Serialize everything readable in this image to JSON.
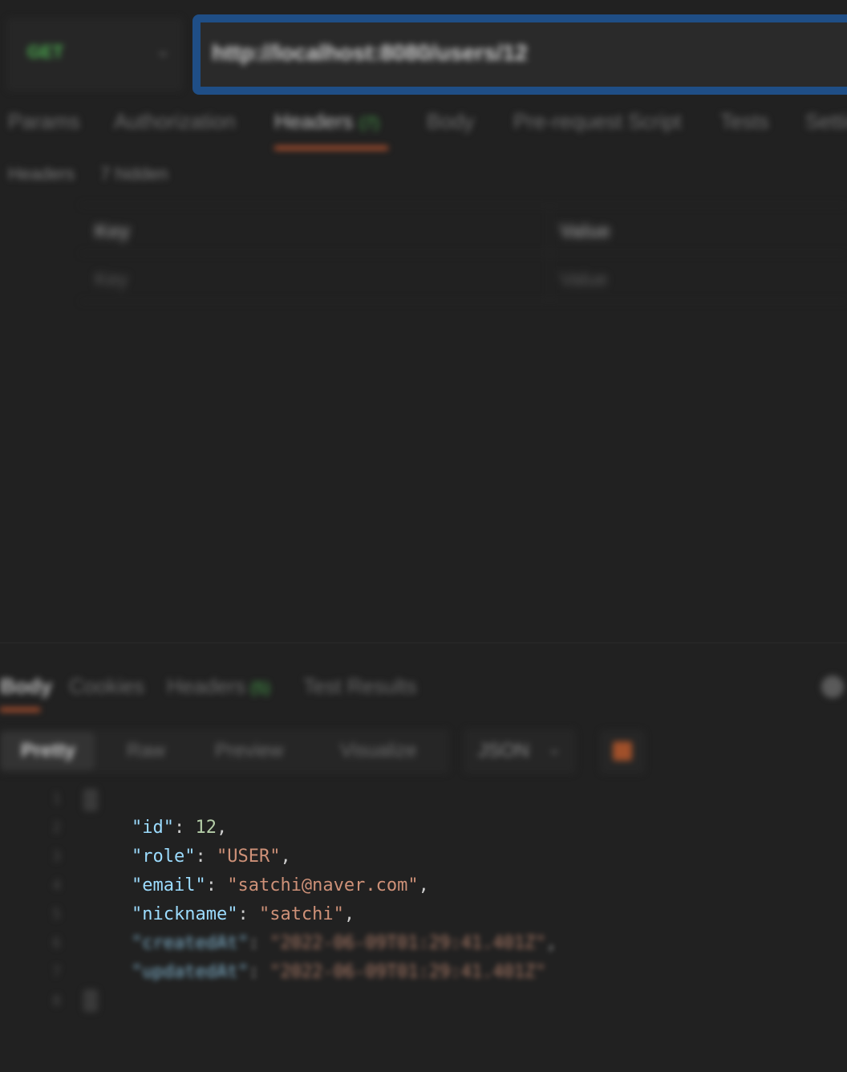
{
  "request": {
    "method": "GET",
    "url": "http://localhost:8080/users/12"
  },
  "request_tabs": [
    {
      "label": "Params"
    },
    {
      "label": "Authorization"
    },
    {
      "label": "Headers",
      "badge": "(7)"
    },
    {
      "label": "Body"
    },
    {
      "label": "Pre-request Script"
    },
    {
      "label": "Tests"
    },
    {
      "label": "Settings"
    }
  ],
  "headers_sub": {
    "label": "Headers",
    "hidden": "7 hidden"
  },
  "headers_table": {
    "key_header": "Key",
    "value_header": "Value",
    "key_placeholder": "Key",
    "value_placeholder": "Value"
  },
  "response_tabs": [
    {
      "label": "Body"
    },
    {
      "label": "Cookies"
    },
    {
      "label": "Headers",
      "badge": "(5)"
    },
    {
      "label": "Test Results"
    }
  ],
  "view_modes": [
    "Pretty",
    "Raw",
    "Preview",
    "Visualize"
  ],
  "format": "JSON",
  "line_numbers": [
    "1",
    "2",
    "3",
    "4",
    "5",
    "6",
    "7",
    "8"
  ],
  "json_response": {
    "id": {
      "key": "\"id\"",
      "value": "12"
    },
    "role": {
      "key": "\"role\"",
      "value": "\"USER\""
    },
    "email": {
      "key": "\"email\"",
      "value": "\"satchi@naver.com\""
    },
    "nickname": {
      "key": "\"nickname\"",
      "value": "\"satchi\""
    },
    "createdAt": {
      "key": "\"createdAt\"",
      "value": "\"2022-06-09T01:29:41.401Z\""
    },
    "updatedAt": {
      "key": "\"updatedAt\"",
      "value": "\"2022-06-09T01:29:41.401Z\""
    }
  }
}
